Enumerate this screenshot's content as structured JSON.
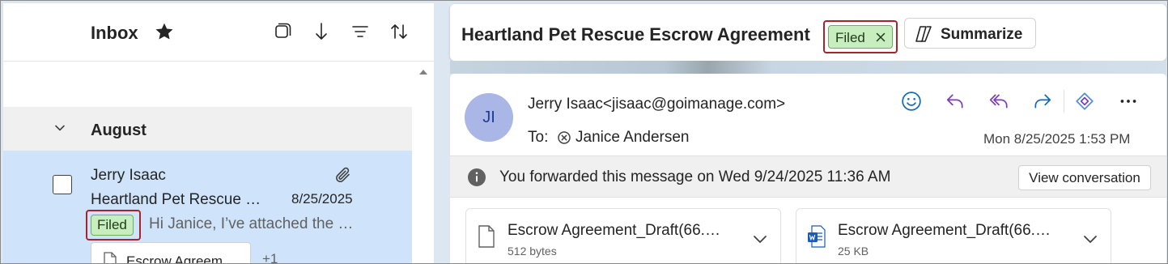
{
  "list": {
    "folder_title": "Inbox",
    "icons": [
      "star-icon",
      "select-mode-icon",
      "sort-down-icon",
      "filter-icon",
      "sort-order-icon"
    ],
    "group_label": "August",
    "item": {
      "sender": "Jerry Isaac",
      "subject": "Heartland Pet Rescue …",
      "date": "8/25/2025",
      "tag": "Filed",
      "preview": "Hi Janice, I’ve attached the …",
      "attachment_chip": "Escrow Agreem…",
      "more_attachments": "+1"
    }
  },
  "reading": {
    "subject": "Heartland Pet Rescue Escrow Agreement",
    "tag": "Filed",
    "summarize_label": "Summarize",
    "avatar_initials": "JI",
    "from": "Jerry Isaac<jisaac@goimanage.com>",
    "to_label": "To:",
    "recipient": "Janice Andersen",
    "sent_date": "Mon 8/25/2025 1:53 PM",
    "actions": [
      "emoji-icon",
      "reply-icon",
      "reply-all-icon",
      "forward-icon",
      "copilot-icon",
      "more-icon"
    ],
    "info_text": "You forwarded this message on Wed 9/24/2025 11:36 AM",
    "view_conversation_label": "View conversation",
    "attachments": [
      {
        "name": "Escrow Agreement_Draft(66.…",
        "size": "512 bytes",
        "icon": "file-icon"
      },
      {
        "name": "Escrow Agreement_Draft(66.…",
        "size": "25 KB",
        "icon": "word-doc-icon"
      }
    ]
  },
  "colors": {
    "accent": "#0f6cbd",
    "action_purple": "#7a3fb8",
    "tag_fill": "#c8eebf",
    "highlight_red": "#a4262c",
    "selected_row": "#cfe4fa"
  }
}
